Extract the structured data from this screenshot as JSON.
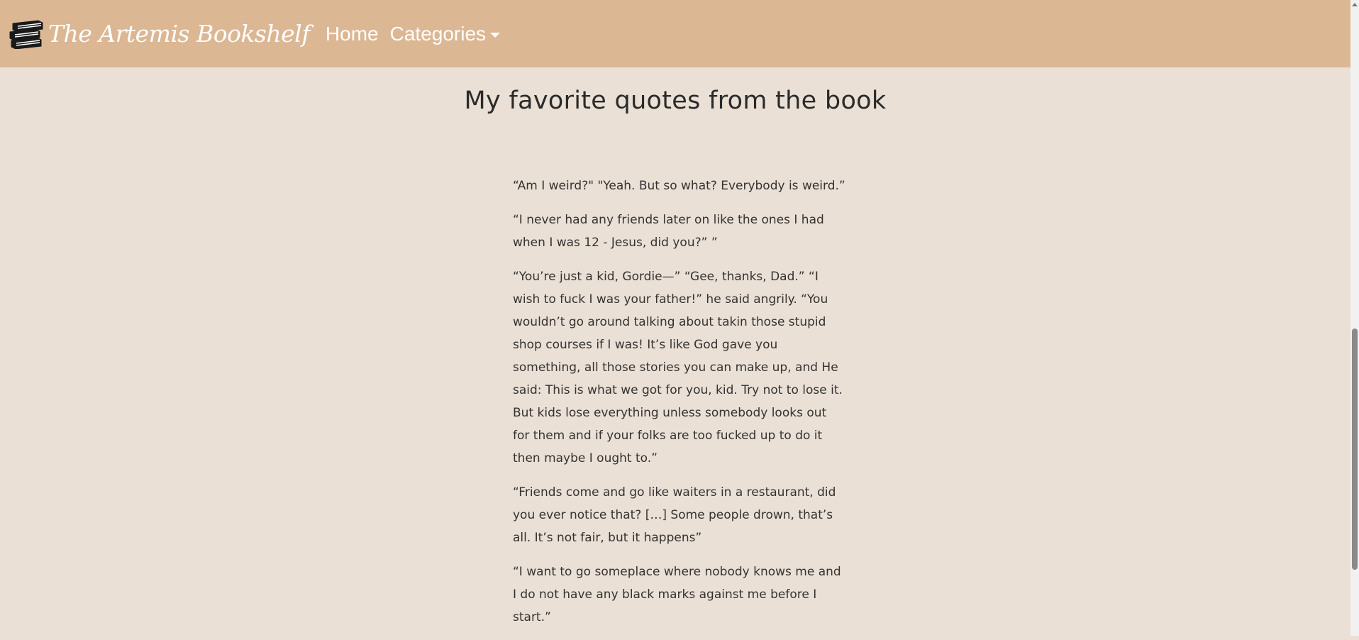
{
  "navbar": {
    "brand_text": "The Artemis Bookshelf",
    "brand_icon": "books-stack-icon",
    "links": {
      "home": "Home",
      "categories": "Categories"
    }
  },
  "main": {
    "title": "My favorite quotes from the book",
    "quotes": [
      "“Am I weird?\" \"Yeah. But so what? Everybody is weird.”",
      "“I never had any friends later on like the ones I had when I was 12 - Jesus, did you?” ”",
      "“You’re just a kid, Gordie—” “Gee, thanks, Dad.” “I wish to fuck I was your father!” he said angrily. “You wouldn’t go around talking about takin those stupid shop courses if I was! It’s like God gave you something, all those stories you can make up, and He said: This is what we got for you, kid. Try not to lose it. But kids lose everything unless somebody looks out for them and if your folks are too fucked up to do it then maybe I ought to.”",
      "“Friends come and go like waiters in a restaurant, did you ever notice that? […] Some people drown, that’s all. It’s not fair, but it happens”",
      "“I want to go someplace where nobody knows me and I do not have any black marks against me before I start.”"
    ]
  },
  "colors": {
    "navbar_bg": "#dcb794",
    "page_bg": "#ebe0d5",
    "text": "#333333"
  }
}
